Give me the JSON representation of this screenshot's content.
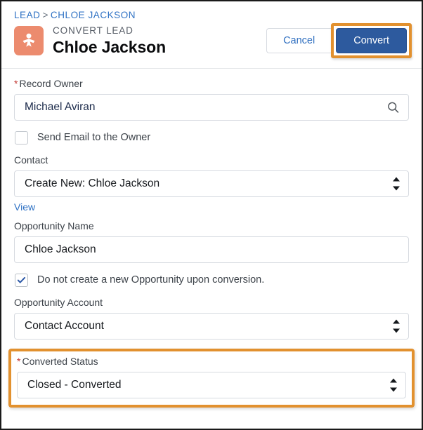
{
  "header": {
    "breadcrumb": {
      "parent": "LEAD",
      "separator": ">",
      "current": "CHLOE JACKSON"
    },
    "record_type": "CONVERT LEAD",
    "record_name": "Chloe Jackson",
    "icon": "lead-person-icon",
    "icon_color": "#EC8B6E",
    "actions": {
      "cancel_label": "Cancel",
      "convert_label": "Convert",
      "convert_color": "#2D5A9E",
      "highlight_color": "#E2912F"
    }
  },
  "form": {
    "record_owner": {
      "label": "Record Owner",
      "required": true,
      "value": "Michael Aviran",
      "icon": "search-icon"
    },
    "send_email": {
      "label": "Send Email to the Owner",
      "checked": false
    },
    "contact": {
      "label": "Contact",
      "required": false,
      "value": "Create New: Chloe Jackson",
      "link_label": "View"
    },
    "opportunity_name": {
      "label": "Opportunity Name",
      "required": false,
      "value": "Chloe Jackson"
    },
    "no_opportunity": {
      "label": "Do not create a new Opportunity upon conversion.",
      "checked": true
    },
    "opportunity_account": {
      "label": "Opportunity Account",
      "required": false,
      "value": "Contact Account"
    },
    "converted_status": {
      "label": "Converted Status",
      "required": true,
      "value": "Closed - Converted",
      "highlighted": true
    }
  }
}
